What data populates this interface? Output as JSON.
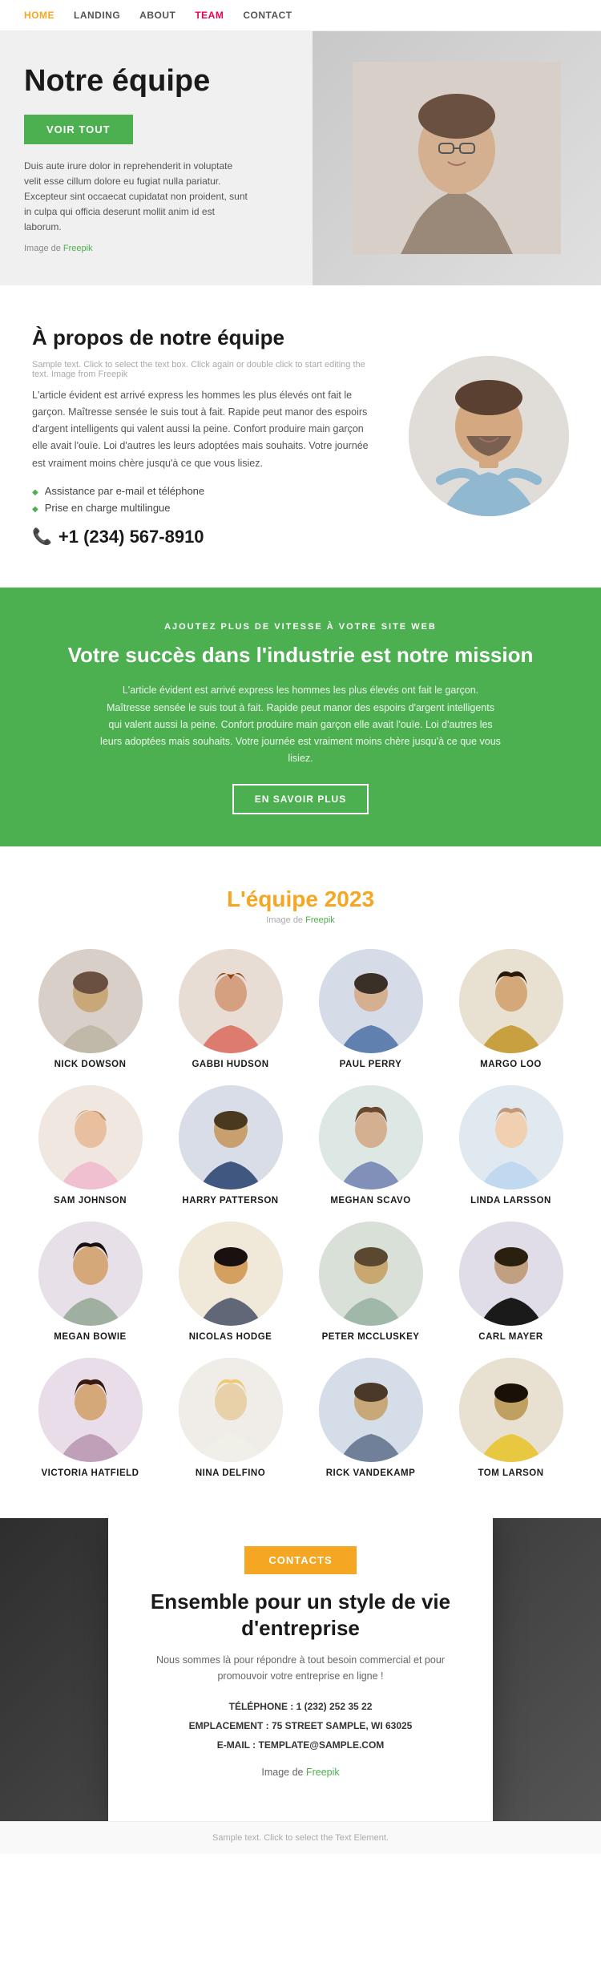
{
  "nav": {
    "items": [
      {
        "label": "HOME",
        "active": true,
        "class": "active"
      },
      {
        "label": "LANDING",
        "active": false
      },
      {
        "label": "ABOUT",
        "active": false
      },
      {
        "label": "TEAM",
        "active": false,
        "class": "team-active"
      },
      {
        "label": "CONTACT",
        "active": false
      }
    ]
  },
  "hero": {
    "title": "Notre équipe",
    "btn": "VOIR TOUT",
    "description": "Duis aute irure dolor in reprehenderit in voluptate velit esse cillum dolore eu fugiat nulla pariatur. Excepteur sint occaecat cupidatat non proident, sunt in culpa qui officia deserunt mollit anim id est laborum.",
    "credit_prefix": "Image de ",
    "credit_link": "Freepik"
  },
  "about": {
    "title": "À propos de notre équipe",
    "sample_text": "Sample text. Click to select the text box. Click again or double click to start editing the text. Image from Freepik",
    "description": "L'article évident est arrivé express les hommes les plus élevés ont fait le garçon. Maîtresse sensée le suis tout à fait. Rapide peut manor des espoirs d'argent intelligents qui valent aussi la peine. Confort produire main garçon elle avait l'ouïe. Loi d'autres les leurs adoptées mais souhaits. Votre journée est vraiment moins chère jusqu'à ce que vous lisiez.",
    "bullets": [
      "Assistance par e-mail et téléphone",
      "Prise en charge multilingue"
    ],
    "phone": "+1 (234) 567-8910"
  },
  "banner": {
    "subtitle": "AJOUTEZ PLUS DE VITESSE À VOTRE SITE WEB",
    "title": "Votre succès dans l'industrie est notre mission",
    "description": "L'article évident est arrivé express les hommes les plus élevés ont fait le garçon. Maîtresse sensée le suis tout à fait. Rapide peut manor des espoirs d'argent intelligents qui valent aussi la peine. Confort produire main garçon elle avait l'ouïe. Loi d'autres les leurs adoptées mais souhaits. Votre journée est vraiment moins chère jusqu'à ce que vous lisiez.",
    "btn": "EN SAVOIR PLUS"
  },
  "team": {
    "title": "L'équipe ",
    "year": "2023",
    "credit_prefix": "Image de ",
    "credit_link": "Freepik",
    "members": [
      {
        "name": "NICK DOWSON"
      },
      {
        "name": "GABBI HUDSON"
      },
      {
        "name": "PAUL PERRY"
      },
      {
        "name": "MARGO LOO"
      },
      {
        "name": "SAM JOHNSON"
      },
      {
        "name": "HARRY PATTERSON"
      },
      {
        "name": "MEGHAN SCAVO"
      },
      {
        "name": "LINDA LARSSON"
      },
      {
        "name": "MEGAN BOWIE"
      },
      {
        "name": "NICOLAS HODGE"
      },
      {
        "name": "PETER MCCLUSKEY"
      },
      {
        "name": "CARL MAYER"
      },
      {
        "name": "VICTORIA HATFIELD"
      },
      {
        "name": "NINA DELFINO"
      },
      {
        "name": "RICK VANDEKAMP"
      },
      {
        "name": "TOM LARSON"
      }
    ]
  },
  "contacts": {
    "btn": "CONTACTS",
    "title": "Ensemble pour un style de vie d'entreprise",
    "description": "Nous sommes là pour répondre à tout besoin commercial et pour promouvoir votre entreprise en ligne !",
    "phone_label": "TÉLÉPHONE :",
    "phone": "1 (232) 252 35 22",
    "location_label": "EMPLACEMENT :",
    "location": "75 STREET SAMPLE, WI 63025",
    "email_label": "E-MAIL :",
    "email": "TEMPLATE@SAMPLE.COM",
    "credit_prefix": "Image de ",
    "credit_link": "Freepik"
  },
  "footer": {
    "text": "Sample text. Click to select the Text Element."
  }
}
